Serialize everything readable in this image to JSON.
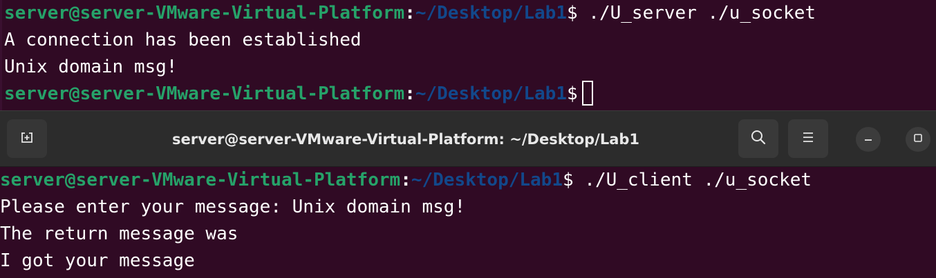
{
  "colors": {
    "terminal_bg": "#300a24",
    "prompt_user": "#26a269",
    "prompt_path": "#12488b",
    "text": "#ffffff",
    "titlebar_bg": "#2c2c2c"
  },
  "top_terminal": {
    "line1": {
      "user": "server@server-VMware-Virtual-Platform",
      "colon": ":",
      "path": "~/Desktop/Lab1",
      "dollar": "$",
      "command": " ./U_server ./u_socket"
    },
    "line2": "A connection has been established",
    "line3": "Unix domain msg!",
    "line4": {
      "user": "server@server-VMware-Virtual-Platform",
      "colon": ":",
      "path": "~/Desktop/Lab1",
      "dollar": "$"
    }
  },
  "titlebar": {
    "title": "server@server-VMware-Virtual-Platform: ~/Desktop/Lab1",
    "new_tab_icon": "new-tab-icon",
    "search_icon": "search-icon",
    "menu_icon": "hamburger-menu-icon",
    "minimize_icon": "minimize-icon",
    "maximize_icon": "maximize-icon"
  },
  "bottom_terminal": {
    "line1": {
      "user": "server@server-VMware-Virtual-Platform",
      "colon": ":",
      "path": "~/Desktop/Lab1",
      "dollar": "$",
      "command": " ./U_client ./u_socket"
    },
    "line2": "Please enter your message: Unix domain msg!",
    "line3": "The return message was",
    "line4": "I got your message"
  }
}
